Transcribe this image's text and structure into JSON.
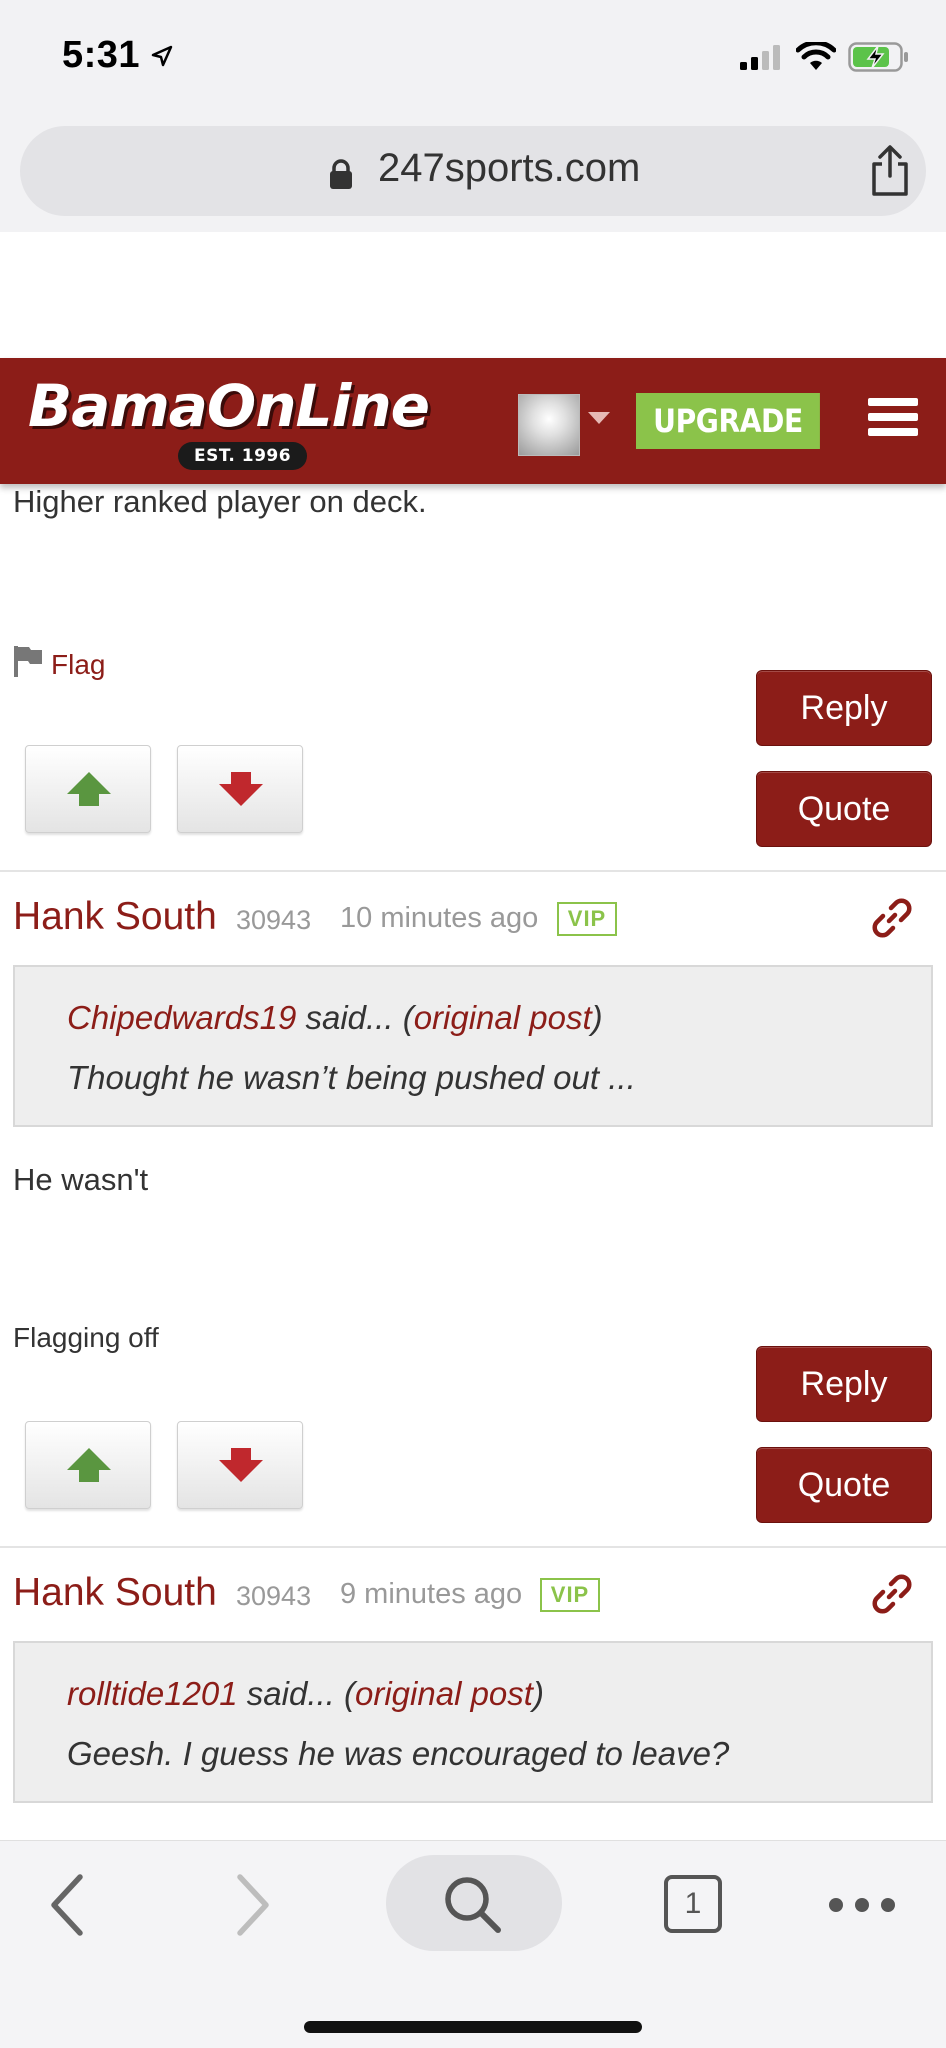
{
  "status_bar": {
    "time": "5:31"
  },
  "browser": {
    "url": "247sports.com"
  },
  "site": {
    "logo": "BamaOnLine",
    "est": "EST. 1996",
    "upgrade_label": "UPGRADE",
    "brand_color": "#8c1d18",
    "upgrade_color": "#8bc34a"
  },
  "posts": [
    {
      "body": "Higher ranked player on deck.",
      "flag_label": "Flag",
      "reply_label": "Reply",
      "quote_label": "Quote"
    },
    {
      "author": "Hank South",
      "points": "30943",
      "time": "10 minutes ago",
      "badge": "VIP",
      "quote_user": "Chipedwards19",
      "quote_said": " said... (",
      "quote_link": "original post",
      "quote_close": ")",
      "quote_text": "Thought he wasn’t being pushed out ...",
      "body": "He wasn't",
      "flag_label": "Flagging off",
      "reply_label": "Reply",
      "quote_label": "Quote"
    },
    {
      "author": "Hank South",
      "points": "30943",
      "time": "9 minutes ago",
      "badge": "VIP",
      "quote_user": "rolltide1201",
      "quote_said": " said... (",
      "quote_link": "original post",
      "quote_close": ")",
      "quote_text": "Geesh. I guess he was encouraged to leave?"
    }
  ],
  "toolbar": {
    "tab_count": "1"
  }
}
